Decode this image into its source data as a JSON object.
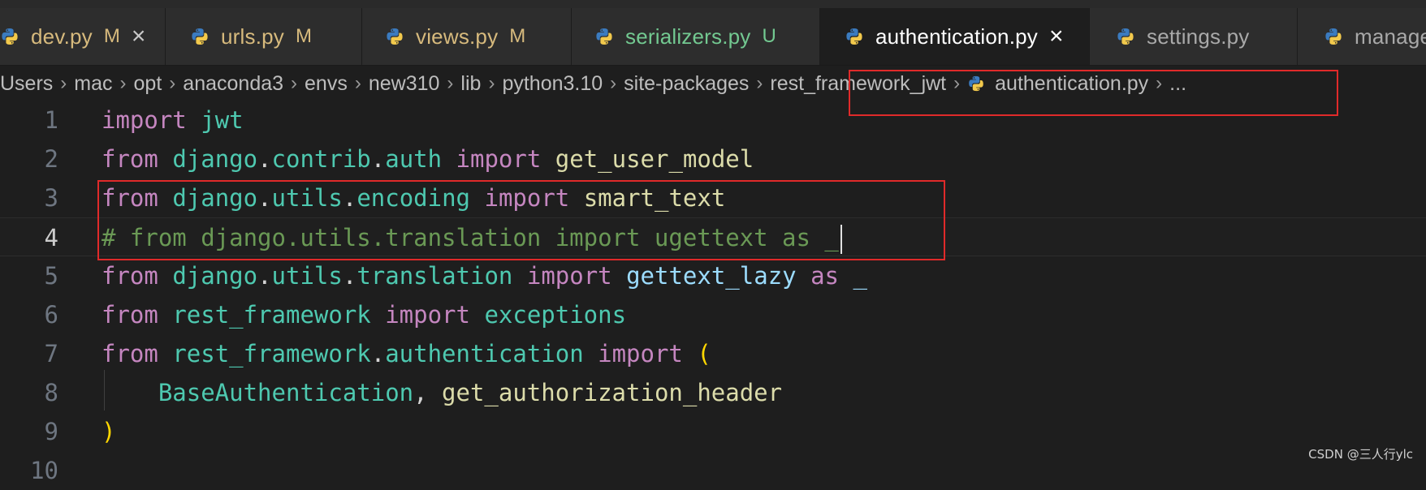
{
  "tabs": [
    {
      "name": "dev.py",
      "badge": "M",
      "badge_kind": "modified",
      "close": "×",
      "active": false
    },
    {
      "name": "urls.py",
      "badge": "M",
      "badge_kind": "modified",
      "active": false
    },
    {
      "name": "views.py",
      "badge": "M",
      "badge_kind": "modified",
      "active": false
    },
    {
      "name": "serializers.py",
      "badge": "U",
      "badge_kind": "untracked",
      "active": false
    },
    {
      "name": "authentication.py",
      "close": "×",
      "active": true
    },
    {
      "name": "settings.py",
      "active": false
    },
    {
      "name": "manage",
      "active": false
    }
  ],
  "breadcrumb": {
    "separator": "›",
    "items": [
      "Users",
      "mac",
      "opt",
      "anaconda3",
      "envs",
      "new310",
      "lib",
      "python3.10",
      "site-packages",
      "rest_framework_jwt",
      "authentication.py",
      "..."
    ]
  },
  "editor": {
    "current_line": 4,
    "lines": [
      {
        "n": "1",
        "t": [
          [
            "import",
            "kw"
          ],
          [
            " ",
            ""
          ],
          [
            "jwt",
            "mod-name"
          ]
        ]
      },
      {
        "n": "2",
        "t": [
          [
            "from",
            "kw"
          ],
          [
            " ",
            ""
          ],
          [
            "django",
            "mod-name"
          ],
          [
            ".",
            "punc"
          ],
          [
            "contrib",
            "mod-name"
          ],
          [
            ".",
            "punc"
          ],
          [
            "auth",
            "mod-name"
          ],
          [
            " ",
            ""
          ],
          [
            "import",
            "kw"
          ],
          [
            " ",
            ""
          ],
          [
            "get_user_model",
            "fn"
          ]
        ]
      },
      {
        "n": "3",
        "t": [
          [
            "from",
            "kw"
          ],
          [
            " ",
            ""
          ],
          [
            "django",
            "mod-name"
          ],
          [
            ".",
            "punc"
          ],
          [
            "utils",
            "mod-name"
          ],
          [
            ".",
            "punc"
          ],
          [
            "encoding",
            "mod-name"
          ],
          [
            " ",
            ""
          ],
          [
            "import",
            "kw"
          ],
          [
            " ",
            ""
          ],
          [
            "smart_text",
            "fn"
          ]
        ]
      },
      {
        "n": "4",
        "t": [
          [
            "# from django.utils.translation import ugettext as _",
            "comment"
          ]
        ]
      },
      {
        "n": "5",
        "t": [
          [
            "from",
            "kw"
          ],
          [
            " ",
            ""
          ],
          [
            "django",
            "mod-name"
          ],
          [
            ".",
            "punc"
          ],
          [
            "utils",
            "mod-name"
          ],
          [
            ".",
            "punc"
          ],
          [
            "translation",
            "mod-name"
          ],
          [
            " ",
            ""
          ],
          [
            "import",
            "kw"
          ],
          [
            " ",
            ""
          ],
          [
            "gettext_lazy",
            "var"
          ],
          [
            " ",
            ""
          ],
          [
            "as",
            "kw"
          ],
          [
            " ",
            ""
          ],
          [
            "_",
            "var"
          ]
        ]
      },
      {
        "n": "6",
        "t": [
          [
            "from",
            "kw"
          ],
          [
            " ",
            ""
          ],
          [
            "rest_framework",
            "mod-name"
          ],
          [
            " ",
            ""
          ],
          [
            "import",
            "kw"
          ],
          [
            " ",
            ""
          ],
          [
            "exceptions",
            "mod-name"
          ]
        ]
      },
      {
        "n": "7",
        "t": [
          [
            "from",
            "kw"
          ],
          [
            " ",
            ""
          ],
          [
            "rest_framework",
            "mod-name"
          ],
          [
            ".",
            "punc"
          ],
          [
            "authentication",
            "mod-name"
          ],
          [
            " ",
            ""
          ],
          [
            "import",
            "kw"
          ],
          [
            " ",
            ""
          ],
          [
            "(",
            "paren"
          ]
        ]
      },
      {
        "n": "8",
        "t": [
          [
            "    ",
            ""
          ],
          [
            "BaseAuthentication",
            "mod-name"
          ],
          [
            ", ",
            "punc"
          ],
          [
            "get_authorization_header",
            "fn"
          ]
        ]
      },
      {
        "n": "9",
        "t": [
          [
            ")",
            "paren"
          ]
        ]
      },
      {
        "n": "10",
        "t": []
      }
    ]
  },
  "colors": {
    "highlight_box": "#e02a2a",
    "python_icon_blue": "#3b7bbf",
    "python_icon_yellow": "#f2c94c"
  },
  "watermark": "CSDN @三人行ylc"
}
